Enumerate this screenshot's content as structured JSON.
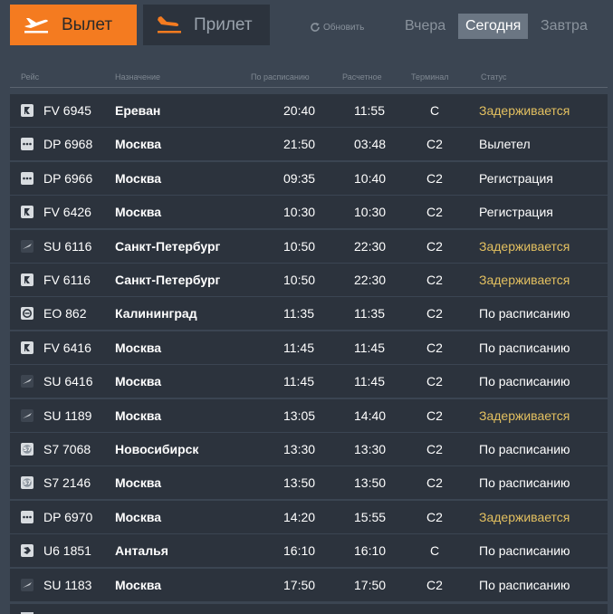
{
  "tabs": {
    "departure": {
      "label": "Вылет",
      "icon": "plane-takeoff-icon",
      "color": "#f47b20"
    },
    "arrival": {
      "label": "Прилет",
      "icon": "plane-landing-icon"
    }
  },
  "refresh": {
    "label": "Обновить",
    "icon": "refresh-icon"
  },
  "days": {
    "yesterday": "Вчера",
    "today": "Сегодня",
    "tomorrow": "Завтра",
    "selected": "today"
  },
  "columns": {
    "flight": "Рейс",
    "destination": "Назначение",
    "scheduled": "По расписанию",
    "estimated": "Расчетное",
    "terminal": "Терминал",
    "status": "Статус"
  },
  "colors": {
    "delayed": "#e3c060",
    "row_bg": "#2c333d",
    "page_bg": "#3b4552"
  },
  "flights": [
    {
      "logo": "rusline-logo-icon",
      "flight": "FV 6945",
      "destination": "Ереван",
      "scheduled": "20:40",
      "estimated": "11:55",
      "terminal": "C",
      "status": "Задерживается",
      "delayed": true
    },
    {
      "logo": "pobeda-logo-icon",
      "flight": "DP 6968",
      "destination": "Москва",
      "scheduled": "21:50",
      "estimated": "03:48",
      "terminal": "C2",
      "status": "Вылетел",
      "delayed": false
    },
    {
      "logo": "pobeda-logo-icon",
      "flight": "DP 6966",
      "destination": "Москва",
      "scheduled": "09:35",
      "estimated": "10:40",
      "terminal": "C2",
      "status": "Регистрация",
      "delayed": false
    },
    {
      "logo": "rusline-logo-icon",
      "flight": "FV 6426",
      "destination": "Москва",
      "scheduled": "10:30",
      "estimated": "10:30",
      "terminal": "C2",
      "status": "Регистрация",
      "delayed": false
    },
    {
      "logo": "aeroflot-logo-icon",
      "flight": "SU 6116",
      "destination": "Санкт-Петербург",
      "scheduled": "10:50",
      "estimated": "22:30",
      "terminal": "C2",
      "status": "Задерживается",
      "delayed": true
    },
    {
      "logo": "rusline-logo-icon",
      "flight": "FV 6116",
      "destination": "Санкт-Петербург",
      "scheduled": "10:50",
      "estimated": "22:30",
      "terminal": "C2",
      "status": "Задерживается",
      "delayed": true
    },
    {
      "logo": "azurair-logo-icon",
      "flight": "EO 862",
      "destination": "Калининград",
      "scheduled": "11:35",
      "estimated": "11:35",
      "terminal": "C2",
      "status": "По расписанию",
      "delayed": false
    },
    {
      "logo": "rusline-logo-icon",
      "flight": "FV 6416",
      "destination": "Москва",
      "scheduled": "11:45",
      "estimated": "11:45",
      "terminal": "C2",
      "status": "По расписанию",
      "delayed": false
    },
    {
      "logo": "aeroflot-logo-icon",
      "flight": "SU 6416",
      "destination": "Москва",
      "scheduled": "11:45",
      "estimated": "11:45",
      "terminal": "C2",
      "status": "По расписанию",
      "delayed": false
    },
    {
      "logo": "aeroflot-logo-icon",
      "flight": "SU 1189",
      "destination": "Москва",
      "scheduled": "13:05",
      "estimated": "14:40",
      "terminal": "C2",
      "status": "Задерживается",
      "delayed": true
    },
    {
      "logo": "s7-logo-icon",
      "flight": "S7 7068",
      "destination": "Новосибирск",
      "scheduled": "13:30",
      "estimated": "13:30",
      "terminal": "C2",
      "status": "По расписанию",
      "delayed": false
    },
    {
      "logo": "s7-logo-icon",
      "flight": "S7 2146",
      "destination": "Москва",
      "scheduled": "13:50",
      "estimated": "13:50",
      "terminal": "C2",
      "status": "По расписанию",
      "delayed": false
    },
    {
      "logo": "pobeda-logo-icon",
      "flight": "DP 6970",
      "destination": "Москва",
      "scheduled": "14:20",
      "estimated": "15:55",
      "terminal": "C2",
      "status": "Задерживается",
      "delayed": true
    },
    {
      "logo": "uralairlines-logo-icon",
      "flight": "U6 1851",
      "destination": "Анталья",
      "scheduled": "16:10",
      "estimated": "16:10",
      "terminal": "C",
      "status": "По расписанию",
      "delayed": false
    },
    {
      "logo": "aeroflot-logo-icon",
      "flight": "SU 1183",
      "destination": "Москва",
      "scheduled": "17:50",
      "estimated": "17:50",
      "terminal": "C2",
      "status": "По расписанию",
      "delayed": false
    }
  ]
}
